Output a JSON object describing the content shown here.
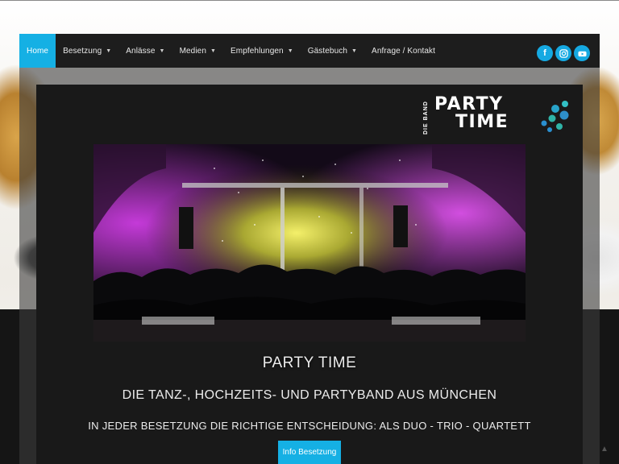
{
  "nav": {
    "items": [
      {
        "label": "Home",
        "active": true,
        "dropdown": false
      },
      {
        "label": "Besetzung",
        "active": false,
        "dropdown": true
      },
      {
        "label": "Anlässe",
        "active": false,
        "dropdown": true
      },
      {
        "label": "Medien",
        "active": false,
        "dropdown": true
      },
      {
        "label": "Empfehlungen",
        "active": false,
        "dropdown": true
      },
      {
        "label": "Gästebuch",
        "active": false,
        "dropdown": true
      },
      {
        "label": "Anfrage / Kontakt",
        "active": false,
        "dropdown": false
      }
    ],
    "social": [
      {
        "icon": "facebook-icon",
        "glyph": "f"
      },
      {
        "icon": "instagram-icon",
        "glyph": "◎"
      },
      {
        "icon": "youtube-icon",
        "glyph": "▶"
      }
    ]
  },
  "logo": {
    "vertical_text": "DIE BAND",
    "line1": "PARTY",
    "line2": "TIME"
  },
  "hero": {
    "title": "PARTY TIME",
    "subtitle": "DIE TANZ-, HOCHZEITS- UND PARTYBAND AUS MÜNCHEN",
    "tagline": "IN JEDER BESETZUNG DIE RICHTIGE ENTSCHEIDUNG: ALS DUO - TRIO - QUARTETT",
    "button_label": "Info Besetzung"
  },
  "colors": {
    "accent": "#15b0e4",
    "nav_bg": "#1d1d1d",
    "panel_bg": "#191919",
    "photo_magenta": "#b02cc6",
    "photo_yellow": "#e6e14a"
  }
}
